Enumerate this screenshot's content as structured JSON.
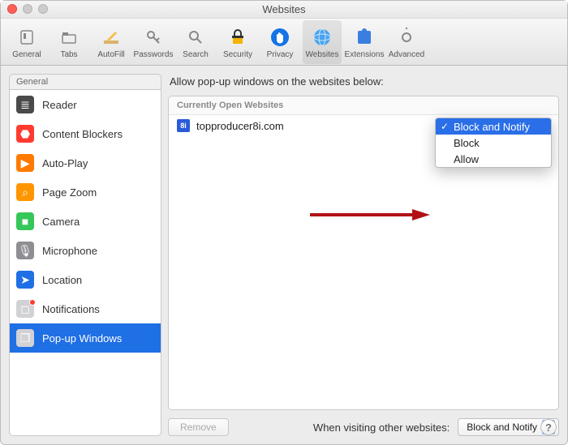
{
  "window": {
    "title": "Websites"
  },
  "toolbar": {
    "items": [
      {
        "label": "General",
        "icon": "switch-icon",
        "selected": false
      },
      {
        "label": "Tabs",
        "icon": "tab-icon",
        "selected": false
      },
      {
        "label": "AutoFill",
        "icon": "pencil-icon",
        "selected": false
      },
      {
        "label": "Passwords",
        "icon": "key-icon",
        "selected": false
      },
      {
        "label": "Search",
        "icon": "search-icon",
        "selected": false
      },
      {
        "label": "Security",
        "icon": "lock-icon",
        "selected": false
      },
      {
        "label": "Privacy",
        "icon": "hand-icon",
        "selected": false
      },
      {
        "label": "Websites",
        "icon": "globe-icon",
        "selected": true
      },
      {
        "label": "Extensions",
        "icon": "puzzle-icon",
        "selected": false
      },
      {
        "label": "Advanced",
        "icon": "gear-icon",
        "selected": false
      }
    ]
  },
  "sidebar": {
    "header": "General",
    "items": [
      {
        "label": "Reader",
        "icon": "reader-icon",
        "color": "#4a4a4a"
      },
      {
        "label": "Content Blockers",
        "icon": "stop-icon",
        "color": "#ff3b30"
      },
      {
        "label": "Auto-Play",
        "icon": "play-icon",
        "color": "#ff7a00"
      },
      {
        "label": "Page Zoom",
        "icon": "zoom-icon",
        "color": "#ff9500"
      },
      {
        "label": "Camera",
        "icon": "camera-icon",
        "color": "#34c759"
      },
      {
        "label": "Microphone",
        "icon": "mic-icon",
        "color": "#8e8e93"
      },
      {
        "label": "Location",
        "icon": "location-icon",
        "color": "#1f6fe5"
      },
      {
        "label": "Notifications",
        "icon": "bell-icon",
        "color": "#d1d1d6",
        "badge": true
      },
      {
        "label": "Pop-up Windows",
        "icon": "popup-icon",
        "color": "#d1d1d6",
        "selected": true
      }
    ]
  },
  "main": {
    "heading": "Allow pop-up windows on the websites below:",
    "list_header": "Currently Open Websites",
    "rows": [
      {
        "site": "topproducer8i.com"
      }
    ],
    "dropdown": {
      "options": [
        {
          "label": "Block and Notify",
          "selected": true
        },
        {
          "label": "Block",
          "selected": false
        },
        {
          "label": "Allow",
          "selected": false
        }
      ]
    },
    "remove_label": "Remove",
    "other_sites_label": "When visiting other websites:",
    "other_sites_value": "Block and Notify"
  },
  "help_glyph": "?"
}
